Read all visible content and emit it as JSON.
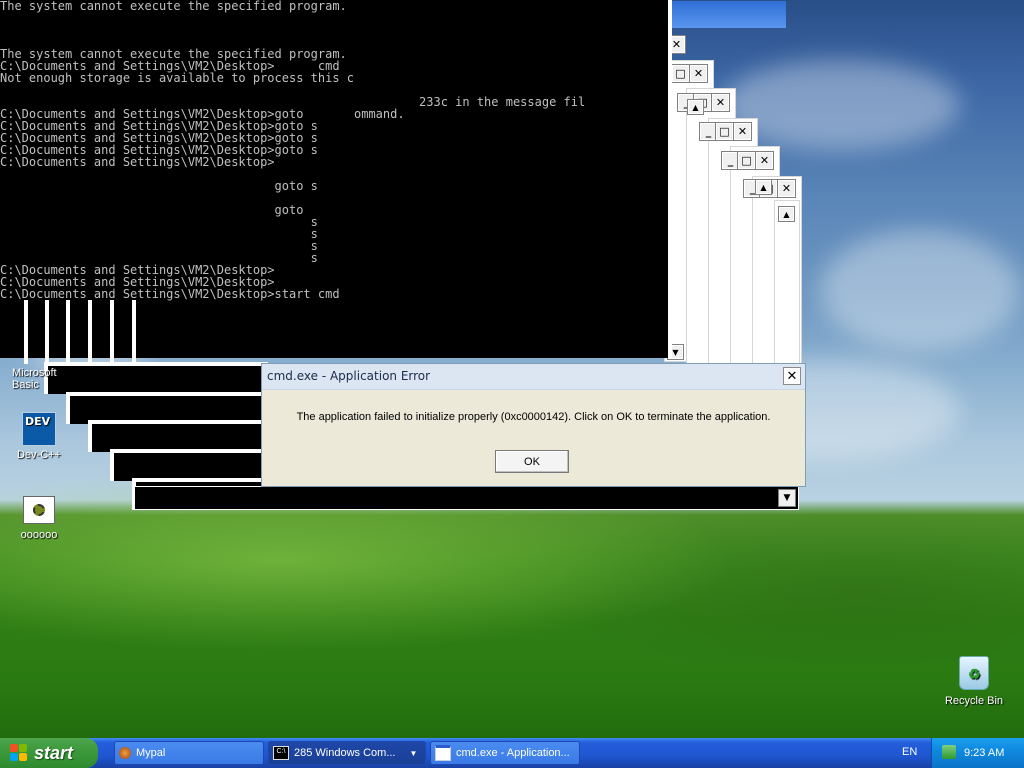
{
  "console": {
    "lines": [
      "The system cannot execute the specified program.",
      "",
      "",
      "",
      "The system cannot execute the specified program.",
      "C:\\Documents and Settings\\VM2\\Desktop>      cmd",
      "Not enough storage is available to process this c",
      "",
      "                                                          233c in the message fil",
      "C:\\Documents and Settings\\VM2\\Desktop>goto       ommand.",
      "C:\\Documents and Settings\\VM2\\Desktop>goto s",
      "C:\\Documents and Settings\\VM2\\Desktop>goto s",
      "C:\\Documents and Settings\\VM2\\Desktop>goto s",
      "C:\\Documents and Settings\\VM2\\Desktop>",
      "",
      "                                      goto s",
      "",
      "                                      goto",
      "                                           s",
      "                                           s",
      "                                           s",
      "                                           s",
      "C:\\Documents and Settings\\VM2\\Desktop>",
      "C:\\Documents and Settings\\VM2\\Desktop>",
      "C:\\Documents and Settings\\VM2\\Desktop>start cmd"
    ]
  },
  "dialog": {
    "title": "cmd.exe - Application Error",
    "message": "The application failed to initialize properly (0xc0000142). Click on OK to terminate the application.",
    "ok_label": "OK",
    "close_glyph": "✕"
  },
  "window_controls": {
    "minimize": "_",
    "maximize": "□",
    "close": "✕",
    "scroll_up": "▲",
    "scroll_down": "▼"
  },
  "desktop_icons": [
    {
      "label": "Microsoft Basic",
      "icon": "app-icon"
    },
    {
      "label": "Dev-C++",
      "icon": "dev-cpp-icon"
    },
    {
      "label": "oooooo",
      "icon": "program-icon"
    },
    {
      "label": "Recycle Bin",
      "icon": "recycle-bin-icon"
    }
  ],
  "taskbar": {
    "start_label": "start",
    "buttons": [
      {
        "label": "Mypal",
        "icon": "mypal-icon"
      },
      {
        "label": "285 Windows Com...",
        "icon": "cmd-icon"
      },
      {
        "label": "cmd.exe - Application...",
        "icon": "window-icon"
      }
    ],
    "language": "EN",
    "clock": "9:23 AM"
  }
}
